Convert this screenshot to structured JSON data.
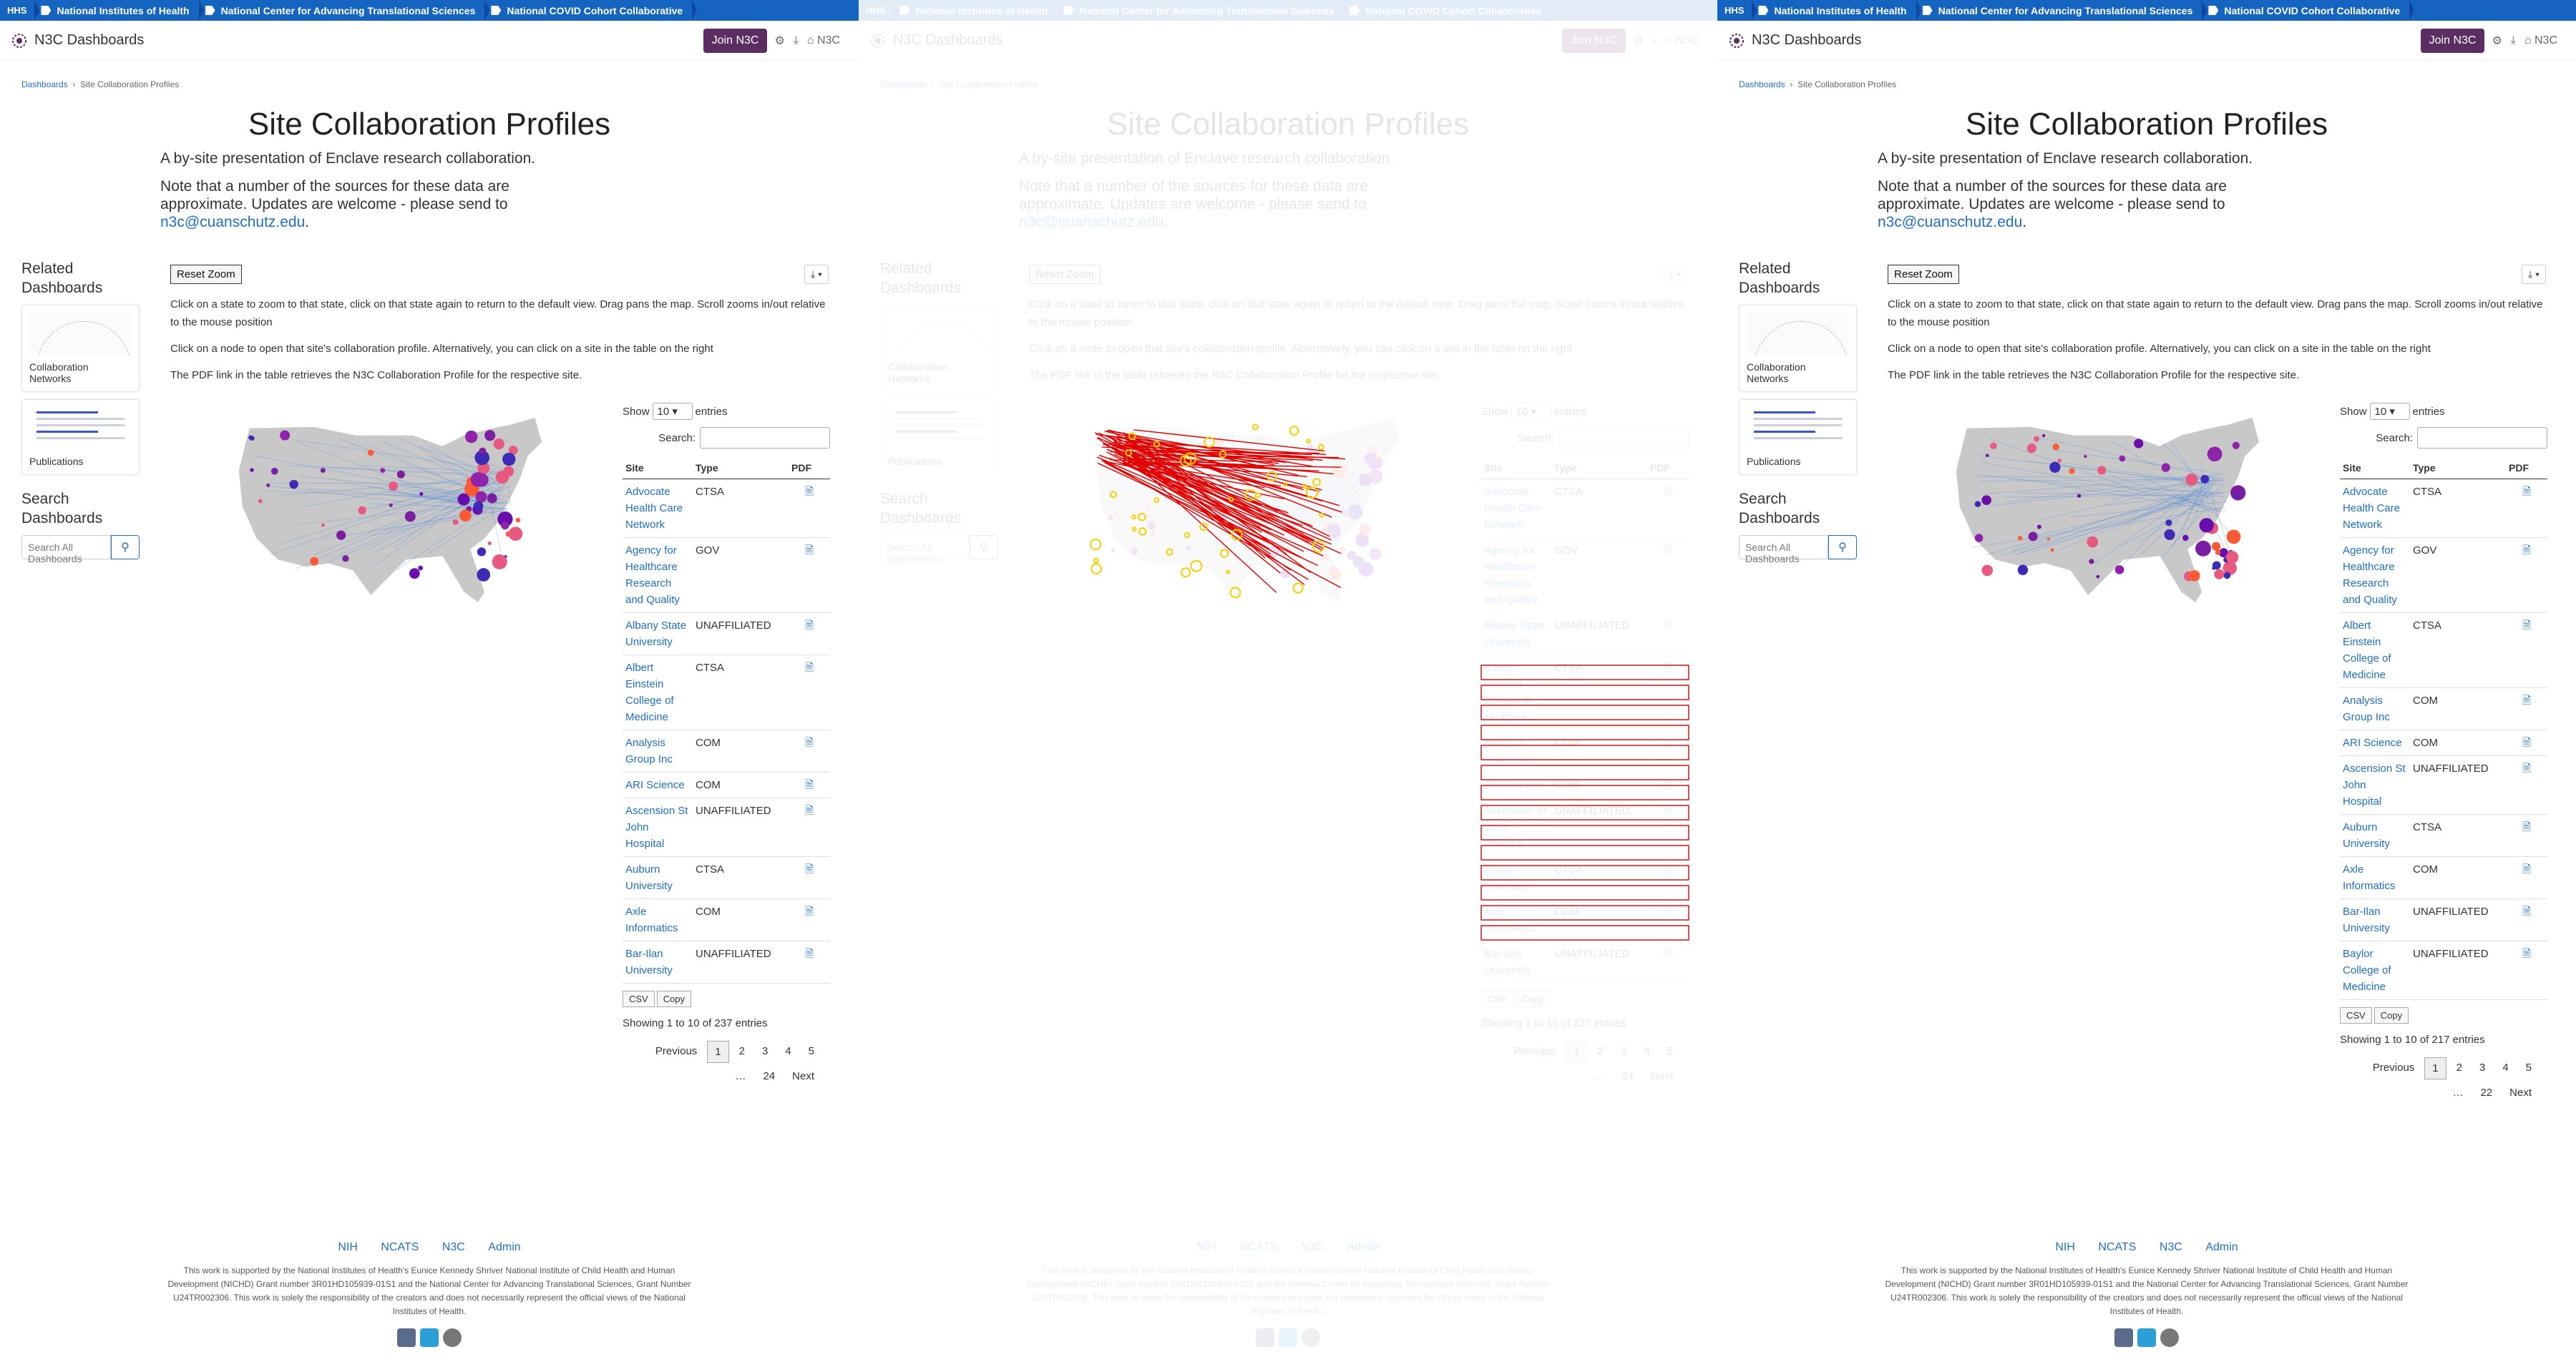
{
  "hhs_bar": {
    "label": "HHS",
    "crumbs": [
      "National Institutes of Health",
      "National Center for Advancing Translational Sciences",
      "National COVID Cohort Collaborative"
    ]
  },
  "topbar": {
    "brand": "N3C Dashboards",
    "join": "Join N3C",
    "n3c_link": "N3C"
  },
  "breadcrumb": {
    "root": "Dashboards",
    "current": "Site Collaboration Profiles"
  },
  "page": {
    "title": "Site Collaboration Profiles",
    "lead": "A by-site presentation of Enclave research collaboration.",
    "note": "Note that a number of the sources for these data are approximate. Updates are welcome - please send to",
    "email": "n3c@cuanschutz.edu",
    "period": "."
  },
  "sidebar": {
    "related": "Related Dashboards",
    "cards": [
      "Collaboration Networks",
      "Publications"
    ],
    "search_heading": "Search Dashboards",
    "search_placeholder": "Search All Dashboards"
  },
  "controls": {
    "reset_zoom": "Reset Zoom",
    "instructions": [
      "Click on a state to zoom to that state, click on that state again to return to the default view. Drag pans the map. Scroll zooms in/out relative to the mouse position",
      "Click on a node to open that site's collaboration profile. Alternatively, you can click on a site in the table on the right",
      "The PDF link in the table retrieves the N3C Collaboration Profile for the respective site."
    ]
  },
  "table": {
    "show": "Show",
    "length": "10",
    "entries": "entries",
    "search_label": "Search:",
    "columns": [
      "Site",
      "Type",
      "PDF"
    ],
    "buttons": [
      "CSV",
      "Copy"
    ],
    "previous": "Previous",
    "next": "Next",
    "left": {
      "rows": [
        {
          "site": "Advocate Health Care Network",
          "type": "CTSA"
        },
        {
          "site": "Agency for Healthcare Research and Quality",
          "type": "GOV"
        },
        {
          "site": "Albany State University",
          "type": "UNAFFILIATED"
        },
        {
          "site": "Albert Einstein College of Medicine",
          "type": "CTSA"
        },
        {
          "site": "Analysis Group Inc",
          "type": "COM"
        },
        {
          "site": "ARI Science",
          "type": "COM"
        },
        {
          "site": "Ascension St John Hospital",
          "type": "UNAFFILIATED"
        },
        {
          "site": "Auburn University",
          "type": "CTSA"
        },
        {
          "site": "Axle Informatics",
          "type": "COM"
        },
        {
          "site": "Bar-Ilan University",
          "type": "UNAFFILIATED"
        }
      ],
      "info": "Showing 1 to 10 of 237 entries",
      "pages": [
        "1",
        "2",
        "3",
        "4",
        "5",
        "…",
        "24"
      ]
    },
    "right": {
      "rows": [
        {
          "site": "Advocate Health Care Network",
          "type": "CTSA"
        },
        {
          "site": "Agency for Healthcare Research and Quality",
          "type": "GOV"
        },
        {
          "site": "Albert Einstein College of Medicine",
          "type": "CTSA"
        },
        {
          "site": "Analysis Group Inc",
          "type": "COM"
        },
        {
          "site": "ARI Science",
          "type": "COM"
        },
        {
          "site": "Ascension St John Hospital",
          "type": "UNAFFILIATED"
        },
        {
          "site": "Auburn University",
          "type": "CTSA"
        },
        {
          "site": "Axle Informatics",
          "type": "COM"
        },
        {
          "site": "Bar-Ilan University",
          "type": "UNAFFILIATED"
        },
        {
          "site": "Baylor College of Medicine",
          "type": "UNAFFILIATED"
        }
      ],
      "info": "Showing 1 to 10 of 217 entries",
      "pages": [
        "1",
        "2",
        "3",
        "4",
        "5",
        "…",
        "22"
      ]
    }
  },
  "footer": {
    "links": [
      "NIH",
      "NCATS",
      "N3C",
      "Admin"
    ],
    "text": "This work is supported by the National Institutes of Health's Eunice Kennedy Shriver National Institute of Child Health and Human Development (NICHD) Grant number 3R01HD105939-01S1 and the National Center for Advancing Translational Sciences, Grant Number U24TR002306. This work is solely the responsibility of the creators and does not necessarily represent the official views of the National Institutes of Health."
  },
  "colors": {
    "hhs_blue": "#1565c0",
    "join_purple": "#5c2d62",
    "link_blue": "#1f6fc5",
    "diff_red": "#e00000",
    "diff_yellow": "#f4d000"
  }
}
